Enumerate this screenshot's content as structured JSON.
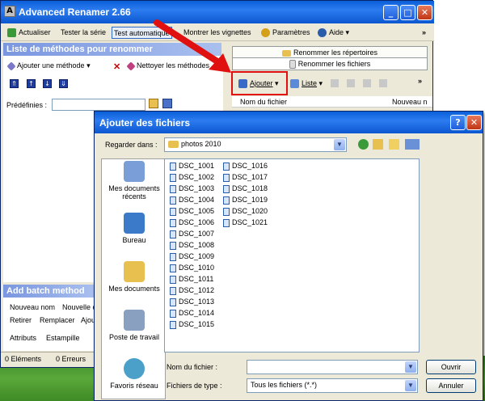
{
  "app": {
    "title": "Advanced Renamer 2.66",
    "toolbar": {
      "actualiser": "Actualiser",
      "tester": "Tester la série",
      "test_auto": "Test automatique",
      "vignettes": "Montrer les vignettes",
      "parametres": "Paramètres",
      "aide": "Aide",
      "overflow": "»"
    },
    "left_panel": {
      "title": "Liste de méthodes pour renommer",
      "add_method": "Ajouter une méthode",
      "clean_methods": "Nettoyer les méthodes",
      "predefinies_label": "Prédéfinies :"
    },
    "batch": {
      "title": "Add batch method",
      "row1": [
        "Nouveau nom",
        "Nouvelle c"
      ],
      "row2": [
        "Retirer",
        "Remplacer",
        "Ajou"
      ],
      "row3": [
        "Attributs",
        "Estampille"
      ]
    },
    "status": {
      "elements": "0 Eléments",
      "erreurs": "0 Erreurs"
    },
    "right_panel": {
      "tab_dirs": "Renommer les répertoires",
      "tab_files": "Renommer les fichiers",
      "ajouter": "Ajouter",
      "liste": "Liste",
      "overflow": "»",
      "col_name": "Nom du fichier",
      "col_new": "Nouveau n"
    }
  },
  "dialog": {
    "title": "Ajouter des fichiers",
    "help": "?",
    "close": "✕",
    "look_in_label": "Regarder dans :",
    "look_in_value": "photos 2010",
    "places": [
      "Mes documents récents",
      "Bureau",
      "Mes documents",
      "Poste de travail",
      "Favoris réseau"
    ],
    "files_col1": [
      "DSC_1001",
      "DSC_1002",
      "DSC_1003",
      "DSC_1004",
      "DSC_1005",
      "DSC_1006",
      "DSC_1007",
      "DSC_1008",
      "DSC_1009",
      "DSC_1010",
      "DSC_1011",
      "DSC_1012",
      "DSC_1013",
      "DSC_1014",
      "DSC_1015"
    ],
    "files_col2": [
      "DSC_1016",
      "DSC_1017",
      "DSC_1018",
      "DSC_1019",
      "DSC_1020",
      "DSC_1021"
    ],
    "filename_label": "Nom du fichier :",
    "filename_value": "",
    "filetype_label": "Fichiers de type :",
    "filetype_value": "Tous les fichiers (*.*)",
    "open_btn": "Ouvrir",
    "cancel_btn": "Annuler"
  },
  "colors": {
    "title_blue": "#0a5fd8",
    "highlight_red": "#e01010",
    "desktop_green": "#4a9a30"
  }
}
